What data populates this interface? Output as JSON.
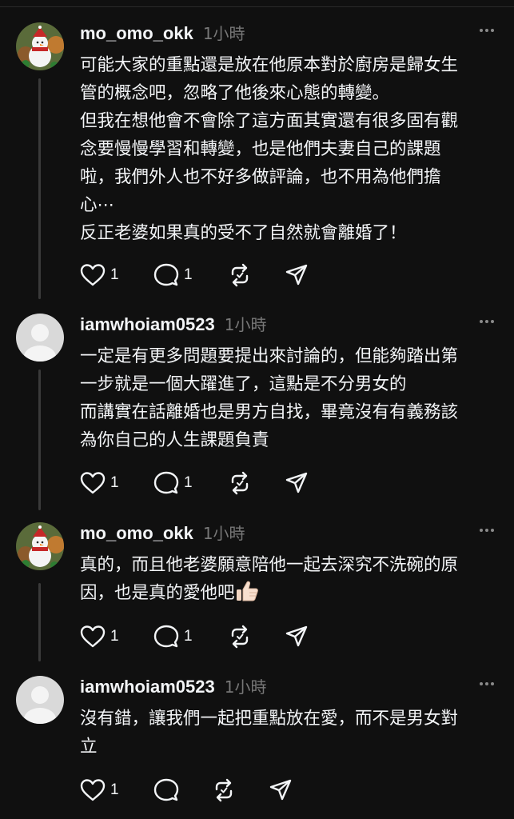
{
  "comments": [
    {
      "username": "mo_omo_okk",
      "time": "1小時",
      "avatar": "snowman-avatar",
      "lines": [
        "可能大家的重點還是放在他原本對於廚房是歸女生",
        "管的概念吧，忽略了他後來心態的轉變。",
        "但我在想他會不會除了這方面其實還有很多固有觀",
        "念要慢慢學習和轉變，也是他們夫妻自己的課題",
        "啦，我們外人也不好多做評論，也不用為他們擔",
        "心⋯",
        "反正老婆如果真的受不了自然就會離婚了！"
      ],
      "likes": "1",
      "replies": "1"
    },
    {
      "username": "iamwhoiam0523",
      "time": "1小時",
      "avatar": "default-avatar",
      "lines": [
        "一定是有更多問題要提出來討論的，但能夠踏出第",
        "一步就是一個大躍進了，這點是不分男女的",
        "而講實在話離婚也是男方自找，畢竟沒有有義務該",
        "為你自己的人生課題負責"
      ],
      "likes": "1",
      "replies": "1"
    },
    {
      "username": "mo_omo_okk",
      "time": "1小時",
      "avatar": "snowman-avatar",
      "lines": [
        "真的，而且他老婆願意陪他一起去深究不洗碗的原",
        "因，也是真的愛他吧"
      ],
      "emoji": "thumbs-up",
      "likes": "1",
      "replies": "1"
    },
    {
      "username": "iamwhoiam0523",
      "time": "1小時",
      "avatar": "default-avatar",
      "lines": [
        "沒有錯，讓我們一起把重點放在愛，而不是男女對",
        "立"
      ],
      "likes": "1",
      "replies": ""
    }
  ],
  "icons": {
    "like": "heart-icon",
    "reply": "comment-icon",
    "repost": "repost-icon",
    "share": "share-icon",
    "more": "more-icon"
  },
  "colors": {
    "background": "#101010",
    "text": "#f3f5f7",
    "muted": "#777777",
    "thread_line": "#3a3a3a"
  }
}
